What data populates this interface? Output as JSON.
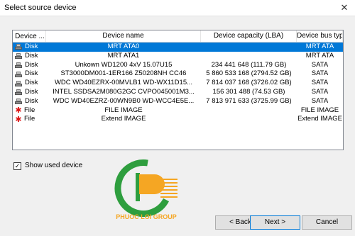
{
  "window": {
    "title": "Select source device",
    "close_glyph": "✕"
  },
  "columns": [
    "Device ...",
    "Device name",
    "Device capacity (LBA)",
    "Device bus type"
  ],
  "rows": [
    {
      "type": "Disk",
      "icon": "disk-icon",
      "name": "MRT ATA0",
      "capacity": "",
      "bus": "MRT ATA",
      "selected": true
    },
    {
      "type": "Disk",
      "icon": "disk-icon",
      "name": "MRT ATA1",
      "capacity": "",
      "bus": "MRT ATA",
      "selected": false
    },
    {
      "type": "Disk",
      "icon": "disk-icon",
      "name": "Unkown WD1200 4xV 15.07U15",
      "capacity": "234 441 648 (111.79 GB)",
      "bus": "SATA",
      "selected": false
    },
    {
      "type": "Disk",
      "icon": "disk-icon",
      "name": "ST3000DM001-1ER166 Z50208NH CC46",
      "capacity": "5 860 533 168 (2794.52 GB)",
      "bus": "SATA",
      "selected": false
    },
    {
      "type": "Disk",
      "icon": "disk-icon",
      "name": "WDC WD40EZRX-00MVLB1 WD-WX11D15...",
      "capacity": "7 814 037 168 (3726.02 GB)",
      "bus": "SATA",
      "selected": false
    },
    {
      "type": "Disk",
      "icon": "disk-icon",
      "name": "INTEL SSDSA2M080G2GC CVPO045001M3...",
      "capacity": "156 301 488 (74.53 GB)",
      "bus": "SATA",
      "selected": false
    },
    {
      "type": "Disk",
      "icon": "disk-icon",
      "name": "WDC WD40EZRZ-00WN9B0 WD-WCC4E5E...",
      "capacity": "7 813 971 633 (3725.99 GB)",
      "bus": "SATA",
      "selected": false
    },
    {
      "type": "File",
      "icon": "file-image-icon",
      "name": "FILE IMAGE",
      "capacity": "",
      "bus": "FILE IMAGE",
      "selected": false
    },
    {
      "type": "File",
      "icon": "file-image-icon",
      "name": "Extend IMAGE",
      "capacity": "",
      "bus": "Extend IMAGE",
      "selected": false
    }
  ],
  "show_used": {
    "label": "Show used device",
    "checked": true,
    "check_glyph": "✓"
  },
  "logo": {
    "text": "PHUOC LOI GROUP"
  },
  "buttons": {
    "back": "< Back",
    "next": "Next >",
    "cancel": "Cancel"
  },
  "colors": {
    "selection": "#0078d7",
    "logo_green": "#2e9e3e",
    "logo_orange": "#f5a623"
  }
}
